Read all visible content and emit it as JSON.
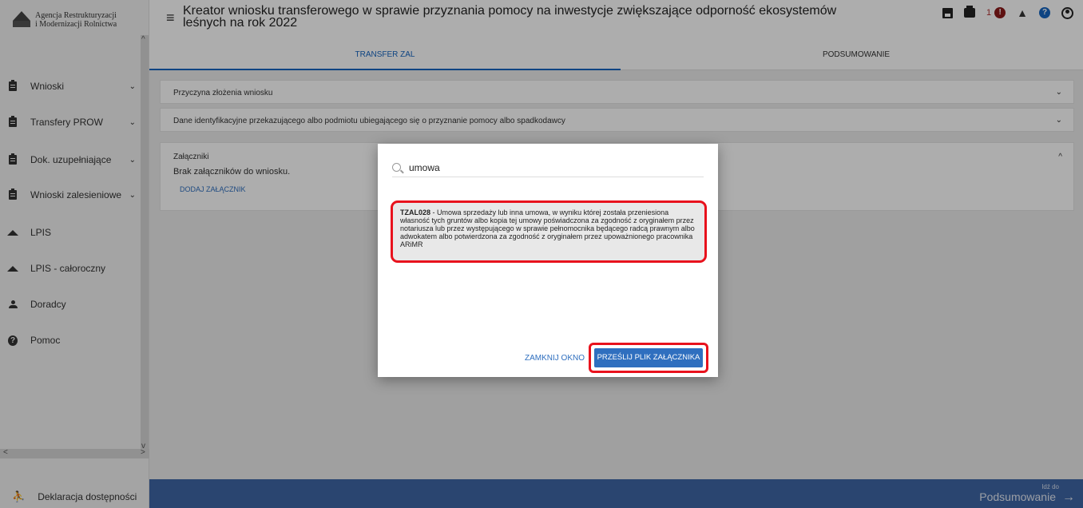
{
  "logo": {
    "line1": "Agencja Restrukturyzacji",
    "line2": "i Modernizacji Rolnictwa"
  },
  "sidebar": {
    "items": [
      {
        "label": "Wnioski",
        "icon": "clipboard-icon",
        "expandable": true
      },
      {
        "label": "Transfery PROW",
        "icon": "clipboard-icon",
        "expandable": true
      },
      {
        "label": "Dok. uzupełniające",
        "icon": "clipboard-icon",
        "expandable": true
      },
      {
        "label": "Wnioski zalesieniowe",
        "icon": "clipboard-icon",
        "expandable": true
      },
      {
        "label": "LPIS",
        "icon": "mountain-icon",
        "expandable": false
      },
      {
        "label": "LPIS - całoroczny",
        "icon": "mountain-icon",
        "expandable": false
      },
      {
        "label": "Doradcy",
        "icon": "person-icon",
        "expandable": false
      },
      {
        "label": "Pomoc",
        "icon": "help-icon",
        "expandable": false
      }
    ],
    "footer": "Deklaracja dostępności"
  },
  "header": {
    "title": "Kreator wniosku transferowego w sprawie przyznania pomocy na inwestycje zwiększające odporność ekosystemów leśnych na rok 2022",
    "notifications_count": "1",
    "alert_glyph": "!",
    "help_glyph": "?",
    "tabs": [
      {
        "label": "TRANSFER ZAL",
        "active": true
      },
      {
        "label": "PODSUMOWANIE",
        "active": false
      }
    ]
  },
  "sections": {
    "reason": "Przyczyna złożenia wniosku",
    "identification": "Dane identyfikacyjne przekazującego albo podmiotu ubiegającego się o przyznanie pomocy albo spadkodawcy",
    "attachments_title": "Załączniki",
    "attachments_empty": "Brak załączników do wniosku.",
    "add_attachment": "DODAJ ZAŁĄCZNIK"
  },
  "dialog": {
    "search_value": "umowa",
    "result_code": "TZAL028",
    "result_text": " - Umowa sprzedaży lub inna umowa, w wyniku której została przeniesiona własność tych gruntów albo kopia tej umowy poświadczona za zgodność z oryginałem przez notariusza lub przez występującego w sprawie pełnomocnika będącego radcą prawnym albo adwokatem albo potwierdzona za zgodność z oryginałem przez upoważnionego pracownika ARiMR",
    "close_label": "ZAMKNIJ OKNO",
    "upload_label": "PRZEŚLIJ PLIK ZAŁĄCZNIKA"
  },
  "footer": {
    "next_small": "Idź do",
    "next_big": "Podsumowanie"
  },
  "colors": {
    "accent": "#2f6fbf",
    "footer_bar": "#3f66a6",
    "highlight": "#e8121d",
    "alert": "#8b1a1a"
  }
}
